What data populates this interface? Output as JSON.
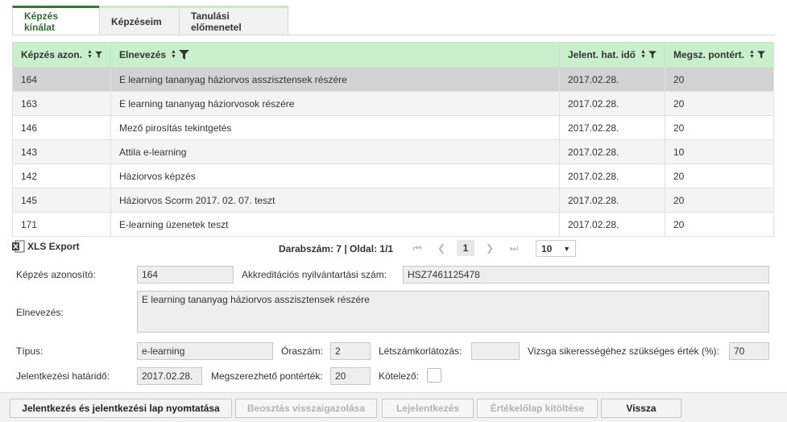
{
  "tabs": [
    {
      "label": "Képzés kínálat"
    },
    {
      "label": "Képzéseim"
    },
    {
      "label": "Tanulási előmenetel"
    }
  ],
  "table": {
    "columns": [
      {
        "label": "Képzés azon."
      },
      {
        "label": "Elnevezés"
      },
      {
        "label": "Jelent. hat. idő"
      },
      {
        "label": "Megsz. pontért."
      }
    ],
    "rows": [
      {
        "id": "164",
        "name": "E learning tananyag háziorvos asszisztensek részére",
        "date": "2017.02.28.",
        "points": "20"
      },
      {
        "id": "163",
        "name": "E learning tananyag háziorvosok részére",
        "date": "2017.02.28.",
        "points": "20"
      },
      {
        "id": "146",
        "name": "Mező pirosítás tekintgetés",
        "date": "2017.02.28.",
        "points": "20"
      },
      {
        "id": "143",
        "name": "Attila e-learning",
        "date": "2017.02.28.",
        "points": "10"
      },
      {
        "id": "142",
        "name": "Háziorvos képzés",
        "date": "2017.02.28.",
        "points": "20"
      },
      {
        "id": "145",
        "name": "Háziorvos Scorm 2017. 02. 07. teszt",
        "date": "2017.02.28.",
        "points": "20"
      },
      {
        "id": "171",
        "name": "E-learning üzenetek teszt",
        "date": "2017.02.28.",
        "points": "20"
      }
    ]
  },
  "export": {
    "label": "XLS Export"
  },
  "pager": {
    "info": "Darabszám: 7 | Oldal: 1/1",
    "current_page": "1",
    "page_size": "10",
    "first": "⏮",
    "prev": "❮",
    "next": "❯",
    "last": "⏭"
  },
  "form": {
    "id_label": "Képzés azonosító:",
    "id_value": "164",
    "accr_label": "Akkreditációs nyilvántartási szám:",
    "accr_value": "HSZ7461125478",
    "name_label": "Elnevezés:",
    "name_value": "E learning tananyag háziorvos asszisztensek részére",
    "type_label": "Típus:",
    "type_value": "e-learning",
    "hours_label": "Óraszám:",
    "hours_value": "2",
    "limit_label": "Létszámkorlátozás:",
    "limit_value": "",
    "exam_label": "Vizsga sikerességéhez szükséges érték (%):",
    "exam_value": "70",
    "deadline_label": "Jelentkezési határidő:",
    "deadline_value": "2017.02.28.",
    "points_label": "Megszerezhető pontérték:",
    "points_value": "20",
    "mandatory_label": "Kötelező:"
  },
  "buttons": {
    "apply_print": "Jelentkezés és jelentkezési lap nyomtatása",
    "confirm": "Beosztás visszaigazolása",
    "unsubscribe": "Lejelentkezés",
    "evaluation": "Értékelőlap kitöltése",
    "back": "Vissza"
  },
  "colors": {
    "header_bg": "#c9f0cc",
    "active_tab_accent": "#2e7d32",
    "selected_row": "#d3d3d3"
  }
}
